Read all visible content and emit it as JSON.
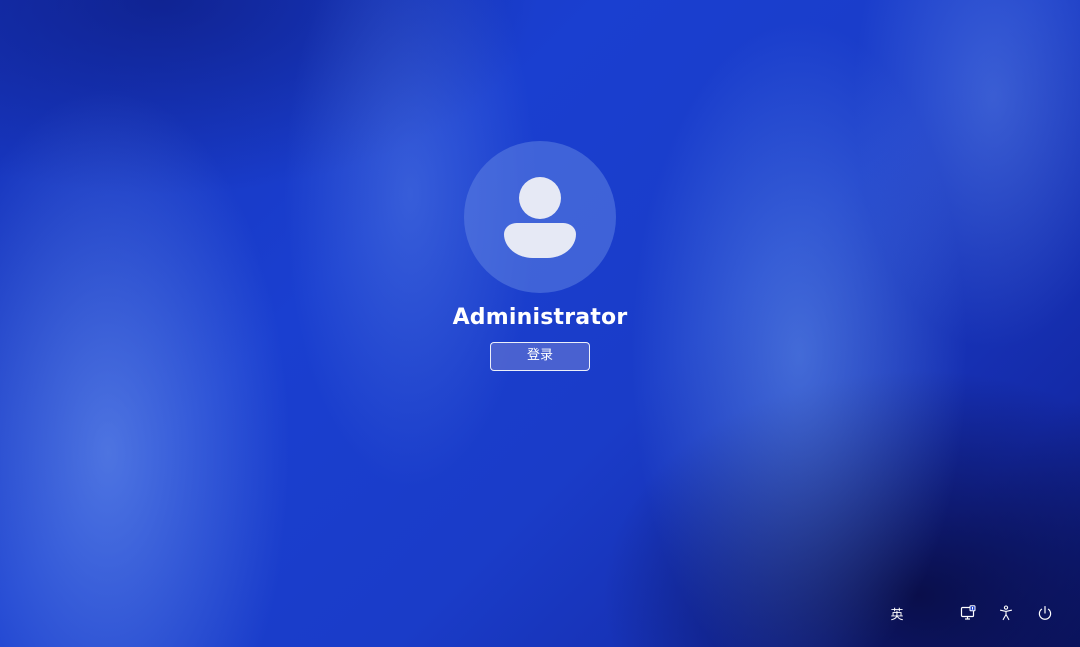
{
  "lock_screen": {
    "user_name": "Administrator",
    "sign_in_label": "登录",
    "avatar_icon": "user-silhouette-icon"
  },
  "tray": {
    "ime_label": "英",
    "network_icon": "network-display-icon",
    "accessibility_icon": "accessibility-icon",
    "power_icon": "power-icon"
  },
  "colors": {
    "wallpaper_base": "#1a3cc8",
    "avatar_glyph": "#e6e9f5",
    "button_fill": "#5a6ed2"
  }
}
